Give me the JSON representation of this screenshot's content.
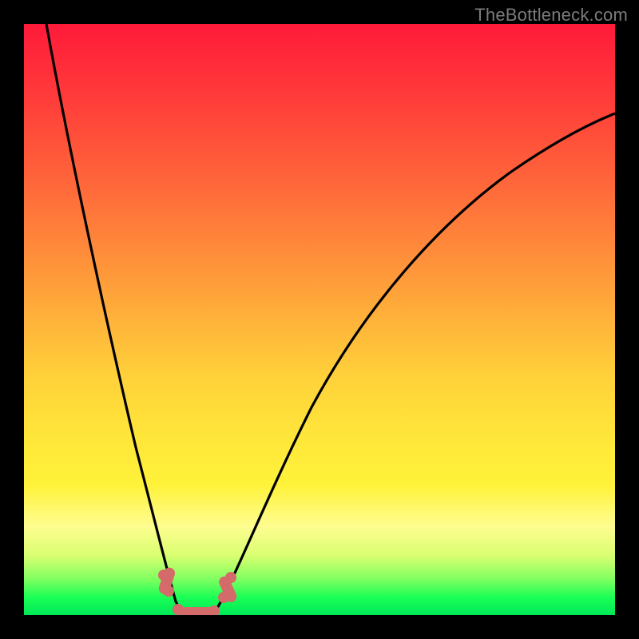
{
  "watermark_text": "TheBottleneck.com",
  "chart_data": {
    "type": "line",
    "title": "",
    "xlabel": "",
    "ylabel": "",
    "xlim": [
      0,
      100
    ],
    "ylim": [
      0,
      100
    ],
    "grid": false,
    "legend": false,
    "background_gradient": {
      "stops": [
        {
          "pos": 0,
          "color": "#ff1a3a"
        },
        {
          "pos": 50,
          "color": "#ffb23a"
        },
        {
          "pos": 80,
          "color": "#fff23a"
        },
        {
          "pos": 100,
          "color": "#00e858"
        }
      ]
    },
    "notes": "Two concave curves descending to a shared trough near x≈24–32; left curve is steep, right curve rises gently toward the upper-right. Markers cluster at the trough.",
    "series": [
      {
        "name": "left-curve",
        "x": [
          4,
          8,
          12,
          16,
          20,
          22,
          24,
          26
        ],
        "values": [
          100,
          80,
          58,
          38,
          18,
          9,
          3,
          0
        ]
      },
      {
        "name": "right-curve",
        "x": [
          32,
          36,
          40,
          46,
          54,
          62,
          70,
          80,
          90,
          100
        ],
        "values": [
          0,
          8,
          18,
          30,
          44,
          55,
          63,
          71,
          78,
          82
        ]
      }
    ],
    "trough_segment": {
      "x": [
        26,
        32
      ],
      "y": [
        0,
        0
      ]
    },
    "markers": [
      {
        "x": 23.5,
        "y": 7
      },
      {
        "x": 24.2,
        "y": 4
      },
      {
        "x": 25.8,
        "y": 0.8
      },
      {
        "x": 28.0,
        "y": 0.4
      },
      {
        "x": 30.0,
        "y": 0.4
      },
      {
        "x": 32.0,
        "y": 0.6
      },
      {
        "x": 33.6,
        "y": 3
      },
      {
        "x": 34.8,
        "y": 6.5
      }
    ],
    "caps": [
      {
        "x": 23.9,
        "y": 5.5,
        "angle": -72
      },
      {
        "x": 29.0,
        "y": 0.4,
        "angle": 0
      },
      {
        "x": 34.2,
        "y": 4.8,
        "angle": 66
      }
    ]
  }
}
